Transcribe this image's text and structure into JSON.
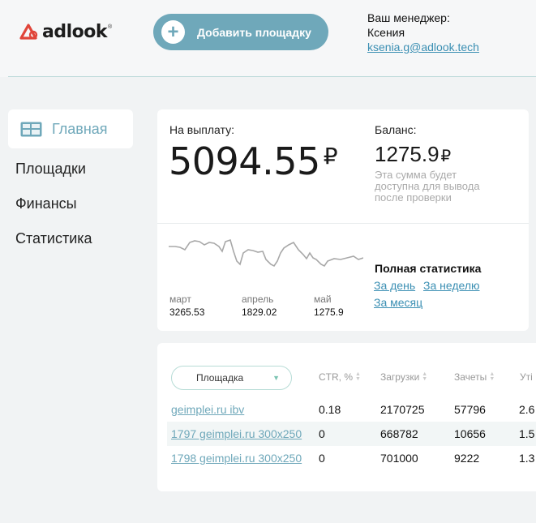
{
  "header": {
    "logo_text": "adlook",
    "logo_reg": "®",
    "add_button_label": "Добавить площадку",
    "manager_label": "Ваш менеджер:",
    "manager_name": "Ксения",
    "manager_email": "ksenia.g@adlook.tech"
  },
  "sidebar": {
    "items": [
      {
        "label": "Главная",
        "icon": "dashboard-icon",
        "active": true
      },
      {
        "label": "Площадки"
      },
      {
        "label": "Финансы"
      },
      {
        "label": "Статистика"
      }
    ]
  },
  "summary": {
    "payout_label": "На выплату:",
    "payout_value": "5094.55",
    "currency": "₽",
    "balance_label": "Баланс:",
    "balance_value": "1275.9",
    "balance_note": "Эта сумма будет доступна для вывода после проверки"
  },
  "chart": {
    "months": [
      {
        "name": "март",
        "value": "3265.53"
      },
      {
        "name": "апрель",
        "value": "1829.02"
      },
      {
        "name": "май",
        "value": "1275.9"
      }
    ],
    "full_stats_label": "Полная статистика",
    "links": {
      "day": "За день",
      "week": "За неделю",
      "month": "За месяц"
    }
  },
  "table": {
    "filter_label": "Площадка",
    "columns": [
      "CTR, %",
      "Загрузки",
      "Зачеты",
      "Уті"
    ],
    "rows": [
      {
        "site": "geimplei.ru ibv",
        "ctr": "0.18",
        "loads": "2170725",
        "credits": "57796",
        "extra": "2.6"
      },
      {
        "site": "1797 geimplei.ru 300x250",
        "ctr": "0",
        "loads": "668782",
        "credits": "10656",
        "extra": "1.5"
      },
      {
        "site": "1798 geimplei.ru 300x250",
        "ctr": "0",
        "loads": "701000",
        "credits": "9222",
        "extra": "1.3"
      }
    ]
  },
  "colors": {
    "accent": "#6fa8ba",
    "link": "#3b8fb3",
    "logo_red": "#e0453a"
  }
}
